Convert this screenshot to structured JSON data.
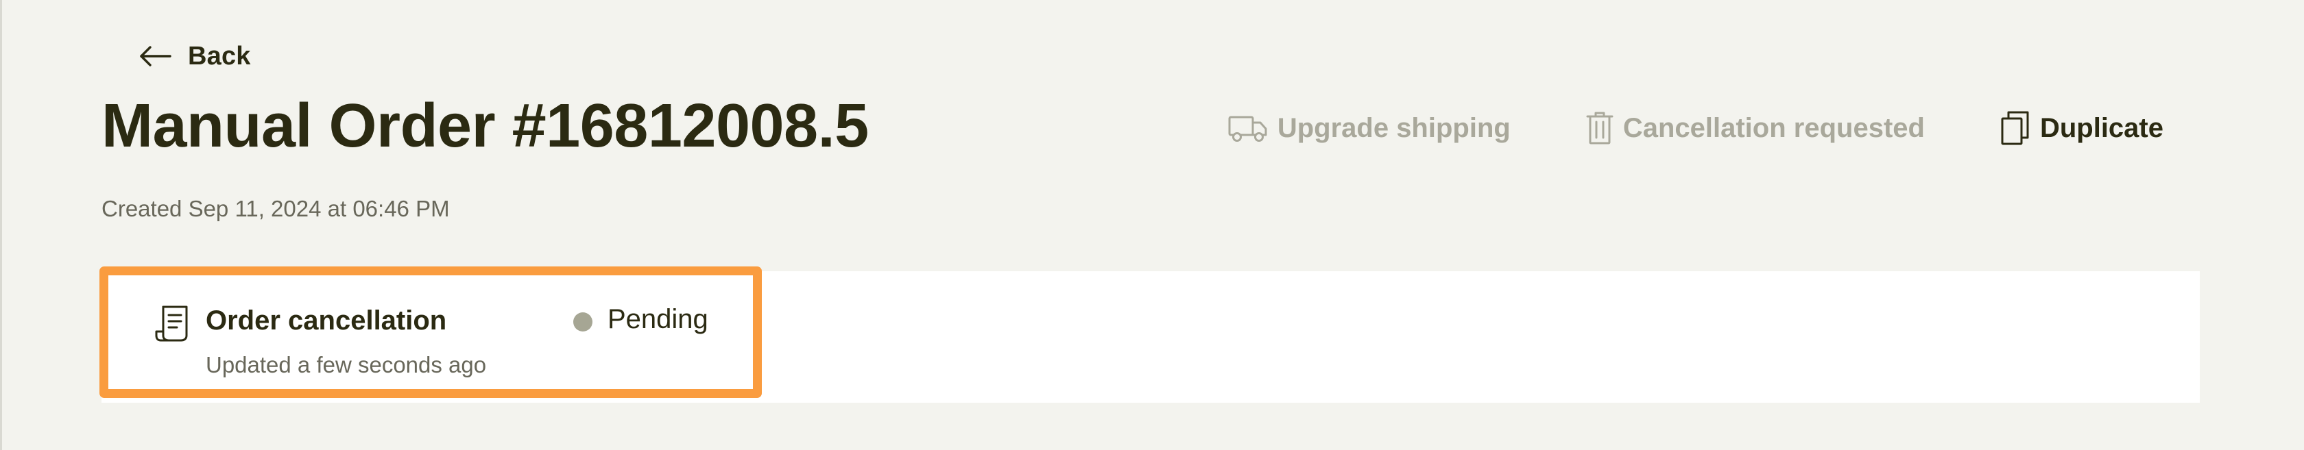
{
  "header": {
    "back_label": "Back",
    "title": "Manual Order #16812008.5",
    "created": "Created Sep 11, 2024 at 06:46 PM"
  },
  "actions": {
    "upgrade_shipping": {
      "label": "Upgrade shipping",
      "icon": "truck-icon",
      "enabled": false
    },
    "cancellation_requested": {
      "label": "Cancellation requested",
      "icon": "trash-icon",
      "enabled": false
    },
    "duplicate": {
      "label": "Duplicate",
      "icon": "copy-icon",
      "enabled": true
    }
  },
  "cancellation_card": {
    "icon": "receipt-icon",
    "title": "Order cancellation",
    "updated": "Updated a few seconds ago",
    "status": "Pending",
    "status_color": "#a6a694",
    "highlight_color": "#fa9c3f"
  },
  "colors": {
    "background": "#f3f3ee",
    "text_primary": "#2b2a12",
    "text_secondary": "#68675a",
    "text_disabled": "#a9a89b"
  }
}
